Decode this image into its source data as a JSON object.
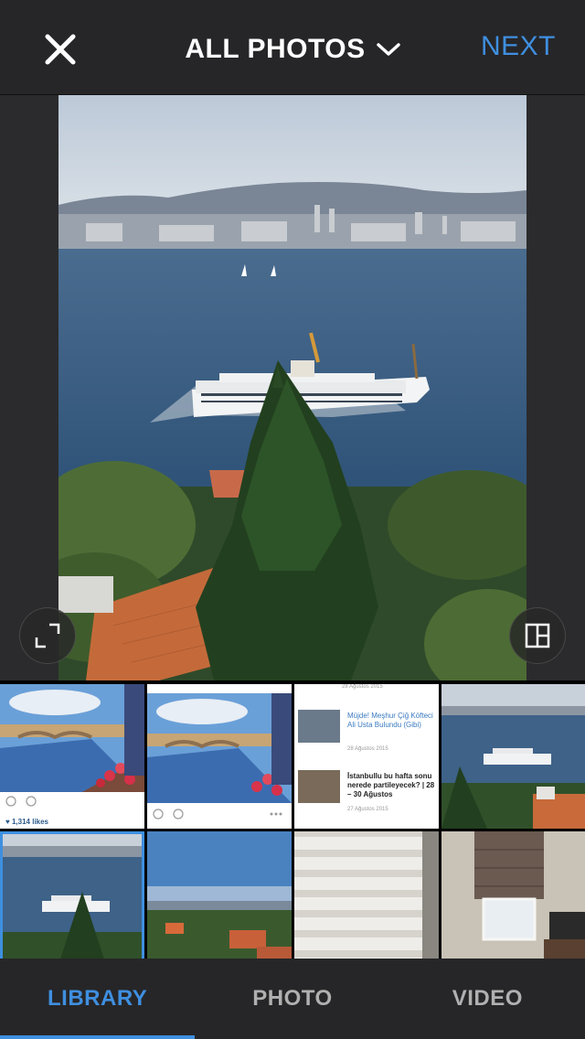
{
  "header": {
    "close_icon": "close-x-icon",
    "title": "ALL PHOTOS",
    "title_icon": "chevron-down-icon",
    "next_label": "NEXT"
  },
  "preview": {
    "expand_icon": "expand-corners-icon",
    "layout_icon": "layout-grid-icon"
  },
  "thumbs": {
    "post1_likes": "♥ 1,314 likes",
    "article1_title": "Müjde! Meşhur Çiğ Köfteci Ali Usta Bulundu (Gibi)",
    "article1_date": "28 Ağustos 2015",
    "article2_title": "İstanbullu bu hafta sonu nerede partileyecek? | 28 – 30 Ağustos",
    "article2_date": "27 Ağustos 2015",
    "article_header_date": "28 Ağustos 2015"
  },
  "tabs": [
    {
      "label": "LIBRARY",
      "active": true
    },
    {
      "label": "PHOTO",
      "active": false
    },
    {
      "label": "VIDEO",
      "active": false
    }
  ],
  "colors": {
    "accent": "#3f8fe0",
    "background": "#262628"
  }
}
